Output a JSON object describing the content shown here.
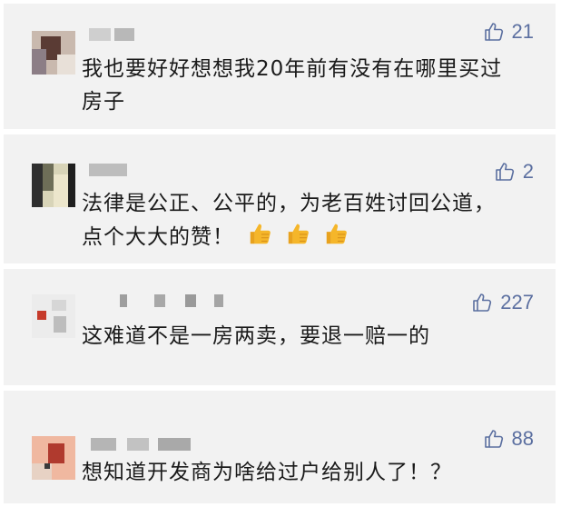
{
  "comments": [
    {
      "likes": "21",
      "text": "我也要好好想想我20年前有没有在哪里买过房子",
      "icon": "thumb-up-outline-icon"
    },
    {
      "likes": "2",
      "text": "法律是公正、公平的，为老百姓讨回公道，点个大大的赞！",
      "emojis": [
        "thumbs-up-emoji",
        "thumbs-up-emoji",
        "thumbs-up-emoji"
      ],
      "icon": "thumb-up-outline-icon"
    },
    {
      "likes": "227",
      "text": "这难道不是一房两卖，要退一赔一的",
      "icon": "thumb-up-outline-icon"
    },
    {
      "likes": "88",
      "text": "想知道开发商为啥给过户给别人了！？",
      "icon": "thumb-up-outline-icon"
    }
  ],
  "colors": {
    "card_bg": "#f2f2f2",
    "like_color": "#5b6fa0",
    "text_color": "#1a1a1a",
    "emoji_color": "#f5b62a"
  }
}
